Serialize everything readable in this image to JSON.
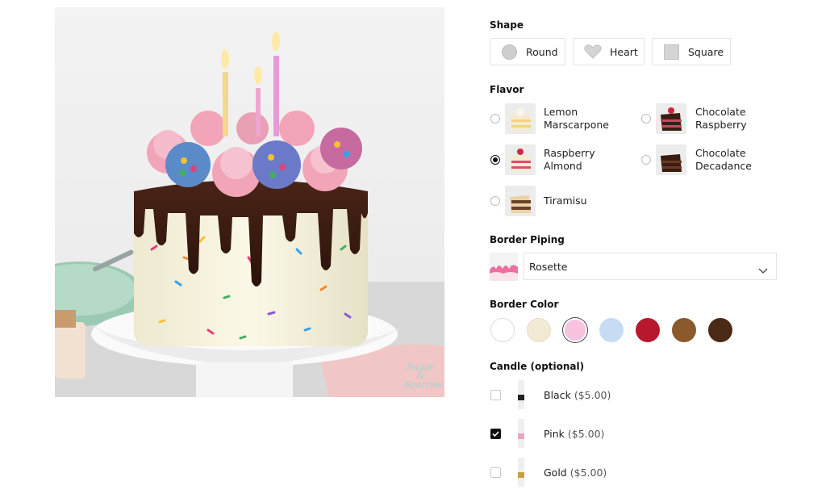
{
  "shape": {
    "title": "Shape",
    "options": [
      {
        "label": "Round",
        "icon": "circle-icon"
      },
      {
        "label": "Heart",
        "icon": "heart-icon"
      },
      {
        "label": "Square",
        "icon": "square-icon"
      }
    ]
  },
  "flavor": {
    "title": "Flavor",
    "options": [
      {
        "label": "Lemon Marscarpone",
        "selected": false
      },
      {
        "label": "Chocolate Raspberry",
        "selected": false
      },
      {
        "label": "Raspberry Almond",
        "selected": true
      },
      {
        "label": "Chocolate Decadance",
        "selected": false
      },
      {
        "label": "Tiramisu",
        "selected": false
      }
    ]
  },
  "border_piping": {
    "title": "Border Piping",
    "selected": "Rosette"
  },
  "border_color": {
    "title": "Border Color",
    "swatches": [
      {
        "name": "white",
        "color": "#ffffff",
        "selected": false
      },
      {
        "name": "cream",
        "color": "#f3ead6",
        "selected": false
      },
      {
        "name": "pink",
        "color": "#f7c3df",
        "selected": true
      },
      {
        "name": "light-blue",
        "color": "#c5dcf3",
        "selected": false
      },
      {
        "name": "red",
        "color": "#b8182b",
        "selected": false
      },
      {
        "name": "caramel",
        "color": "#8a5a2c",
        "selected": false
      },
      {
        "name": "dark-brown",
        "color": "#4a2a14",
        "selected": false
      }
    ]
  },
  "candle": {
    "title": "Candle (optional)",
    "options": [
      {
        "name": "Black",
        "price": "($5.00)",
        "checked": false,
        "color": "#222222"
      },
      {
        "name": "Pink",
        "price": "($5.00)",
        "checked": true,
        "color": "#e9a5c4"
      },
      {
        "name": "Gold",
        "price": "($5.00)",
        "checked": false,
        "color": "#c9a040"
      }
    ]
  },
  "photo": {
    "watermark": "Sugar & Sparrow"
  }
}
